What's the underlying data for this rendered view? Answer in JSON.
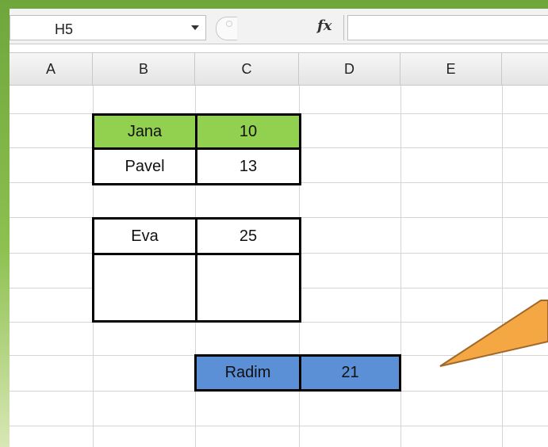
{
  "formula_bar": {
    "name_box": "H5",
    "fx_label": "fx",
    "formula": ""
  },
  "columns": [
    "A",
    "B",
    "C",
    "D",
    "E"
  ],
  "cells": {
    "b2": "Jana",
    "c2": "10",
    "b3": "Pavel",
    "c3": "13",
    "b4": "Eva",
    "c4": "25",
    "c6": "Radim",
    "d6": "21"
  },
  "colors": {
    "green_fill": "#92d050",
    "blue_fill": "#5b8fd6",
    "callout_fill": "#f4a742",
    "callout_stroke": "#a0692a"
  }
}
